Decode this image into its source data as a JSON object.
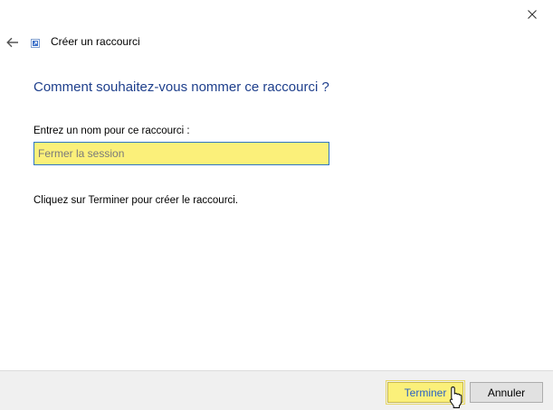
{
  "window": {
    "title": "Créer un raccourci",
    "close_icon": "close-icon",
    "back_icon": "back-arrow-icon",
    "shortcut_icon": "shortcut-icon"
  },
  "main": {
    "heading": "Comment souhaitez-vous nommer ce raccourci ?",
    "name_label": "Entrez un nom pour ce raccourci :",
    "name_value": "Fermer la session",
    "instruction": "Cliquez sur Terminer pour créer le raccourci."
  },
  "footer": {
    "finish_label": "Terminer",
    "cancel_label": "Annuler"
  },
  "colors": {
    "heading": "#1e3f8c",
    "highlight": "#fbf07a",
    "input_border": "#2e76c7",
    "finish_text": "#2a62c4"
  }
}
